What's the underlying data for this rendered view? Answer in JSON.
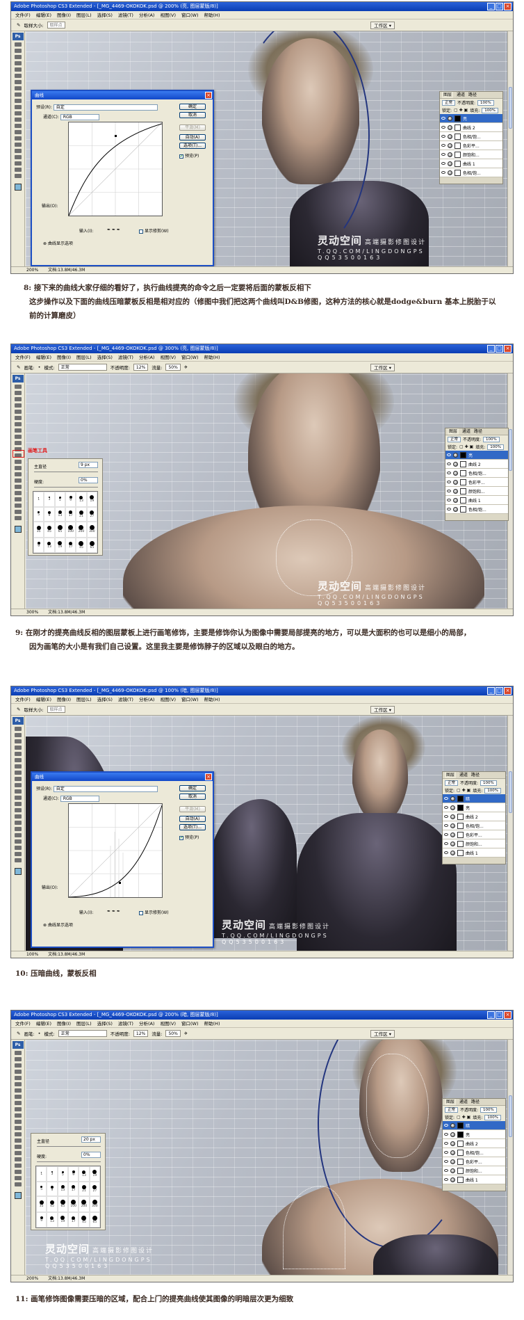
{
  "common": {
    "menu": [
      "文件(F)",
      "编辑(E)",
      "图像(I)",
      "图层(L)",
      "选择(S)",
      "滤镜(T)",
      "分析(A)",
      "视图(V)",
      "窗口(W)",
      "帮助(H)"
    ],
    "workspace": "工作区 ▾",
    "doc_size": "文档:13.8M/46.3M",
    "layer_tabs": [
      "图层",
      "通道",
      "路径"
    ],
    "blend_mode": "正常",
    "opacity_label": "不透明度:",
    "opacity_value": "100%",
    "fill_label": "填充:",
    "fill_value": "100%",
    "lock_label": "锁定:",
    "watermark": {
      "line1": "灵动空间",
      "line2": "高端摄影修图设计",
      "line3": "T.QQ.COM/LINGDONGPS",
      "line4": "QQ53500163"
    },
    "curves": {
      "title": "曲线",
      "preset_label": "预设(R):",
      "preset_value": "自定",
      "channel_label": "通道(C):",
      "channel_value": "RGB",
      "output_label": "输出(O):",
      "input_label": "输入(I):",
      "ok": "确定",
      "cancel": "取消",
      "smooth": "平滑(M)",
      "auto": "自动(A)",
      "options": "选项(T)...",
      "preview": "预览(P)",
      "show_clip": "显示修剪(W)",
      "display_opts": "曲线显示选项"
    },
    "brush": {
      "master_diameter": "主直径",
      "hardness": "硬度:",
      "hardness_value": "0%"
    }
  },
  "shot1": {
    "title": "Adobe Photoshop CS3 Extended - [_MG_4469-OKOKOK.psd @ 200% (亮, 图层蒙版/8)]",
    "tool_label": "取样大小:",
    "tool_value": "取样点",
    "zoom": "200%",
    "layers": [
      {
        "name": "亮",
        "mask": "black",
        "selected": true
      },
      {
        "name": "曲线 2",
        "mask": "white"
      },
      {
        "name": "色相/饱...",
        "mask": "white"
      },
      {
        "name": "色彩平...",
        "mask": "white"
      },
      {
        "name": "颜饱和...",
        "mask": "white"
      },
      {
        "name": "曲线 1",
        "mask": "white"
      },
      {
        "name": "色相/饱...",
        "mask": "white"
      }
    ]
  },
  "caption1": {
    "line1": "8:  接下来的曲线大家仔细的看好了，执行曲线提亮的命令之后一定要将后面的蒙板反相下",
    "line2": "这步操作以及下面的曲线压暗蒙板反相是相对应的（修图中我们把这两个曲线叫D&B修图，这种方法的核心就是dodge&burn 基本上脱胎于以",
    "line3": "前的计算磨皮）"
  },
  "shot2": {
    "title": "Adobe Photoshop CS3 Extended - [_MG_4469-OKOKOK.psd @ 300% (亮, 图层蒙版/8)]",
    "tool_label": "画笔:",
    "mode_label": "模式:",
    "mode_value": "正常",
    "opacity_label": "不透明度:",
    "opacity_value": "12%",
    "flow_label": "流量:",
    "flow_value": "50%",
    "zoom": "300%",
    "annotation": "画笔工具",
    "brush_size": "9 px",
    "brush_presets": [
      "1",
      "3",
      "5",
      "9",
      "13",
      "19",
      "5",
      "9",
      "13",
      "17",
      "21",
      "27",
      "35",
      "45",
      "65",
      "100",
      "200",
      "300",
      "9",
      "13",
      "19",
      "17",
      "45",
      "65"
    ],
    "layers": [
      {
        "name": "亮",
        "mask": "black",
        "selected": true
      },
      {
        "name": "曲线 2",
        "mask": "white"
      },
      {
        "name": "色相/饱...",
        "mask": "white"
      },
      {
        "name": "色彩平...",
        "mask": "white"
      },
      {
        "name": "颜饱和...",
        "mask": "white"
      },
      {
        "name": "曲线 1",
        "mask": "white"
      },
      {
        "name": "色相/饱...",
        "mask": "white"
      }
    ]
  },
  "caption2": {
    "line1": "9:  在刚才的提亮曲线反相的图层蒙板上进行画笔修饰，主要是修饰你认为图像中需要局部提亮的地方，可以是大面积的也可以是细小的局部，",
    "line2": "因为画笔的大小是有我们自己设置。这里我主要是修饰脖子的区域以及眼白的地方。"
  },
  "shot3": {
    "title": "Adobe Photoshop CS3 Extended - [_MG_4469-OKOKOK.psd @ 100% (暗, 图层蒙版/8)]",
    "tool_label": "取样大小:",
    "tool_value": "取样点",
    "zoom": "100%",
    "layers": [
      {
        "name": "暗",
        "mask": "black",
        "selected": true
      },
      {
        "name": "亮",
        "mask": "black"
      },
      {
        "name": "曲线 2",
        "mask": "white"
      },
      {
        "name": "色相/饱...",
        "mask": "white"
      },
      {
        "name": "色彩平...",
        "mask": "white"
      },
      {
        "name": "颜饱和...",
        "mask": "white"
      },
      {
        "name": "曲线 1",
        "mask": "white"
      }
    ]
  },
  "caption3": {
    "line1": "10:  压暗曲线，蒙板反相"
  },
  "shot4": {
    "title": "Adobe Photoshop CS3 Extended - [_MG_4469-OKOKOK.psd @ 200% (暗, 图层蒙版/8)]",
    "tool_label": "画笔:",
    "mode_label": "模式:",
    "mode_value": "正常",
    "opacity_label": "不透明度:",
    "opacity_value": "12%",
    "flow_label": "流量:",
    "flow_value": "50%",
    "zoom": "200%",
    "brush_size": "20 px",
    "brush_presets": [
      "1",
      "3",
      "5",
      "9",
      "13",
      "19",
      "5",
      "9",
      "13",
      "17",
      "21",
      "27",
      "35",
      "45",
      "65",
      "100",
      "200",
      "300",
      "9",
      "13",
      "19",
      "17",
      "45",
      "65"
    ],
    "layers": [
      {
        "name": "暗",
        "mask": "black",
        "selected": true
      },
      {
        "name": "亮",
        "mask": "black"
      },
      {
        "name": "曲线 2",
        "mask": "white"
      },
      {
        "name": "色相/饱...",
        "mask": "white"
      },
      {
        "name": "色彩平...",
        "mask": "white"
      },
      {
        "name": "颜饱和...",
        "mask": "white"
      },
      {
        "name": "曲线 1",
        "mask": "white"
      }
    ]
  },
  "caption4": {
    "line1": "11:  画笔修饰图像需要压暗的区域，配合上门的提亮曲线使其图像的明暗层次更为细致"
  }
}
